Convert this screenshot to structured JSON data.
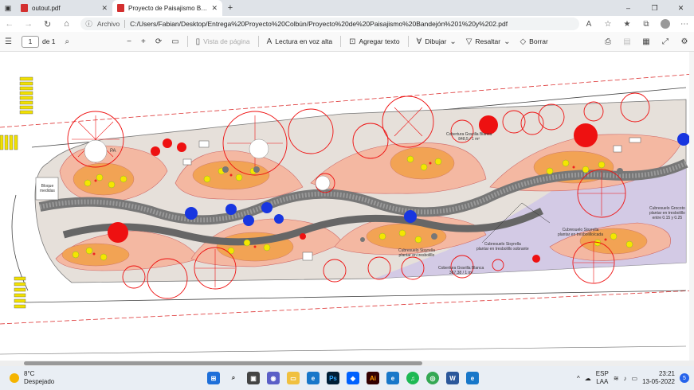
{
  "tabs": [
    {
      "title": "outout.pdf",
      "close": "✕"
    },
    {
      "title": "Proyecto de Paisajismo Bandejó",
      "close": "✕"
    }
  ],
  "window_controls": [
    "–",
    "❐",
    "✕"
  ],
  "address": {
    "scheme": "Archivo",
    "url": "C:/Users/Fabian/Desktop/Entrega%20Proyecto%20Colbún/Proyecto%20de%20Paisajismo%20Bandejón%201%20y%202.pdf"
  },
  "pdf_toolbar": {
    "page_current": "1",
    "page_total": "de 1",
    "view_page": "Vista de página",
    "read_aloud": "Lectura en voz alta",
    "add_text": "Agregar texto",
    "draw": "Dibujar",
    "highlight": "Resaltar",
    "erase": "Borrar"
  },
  "plan_labels": {
    "cobertura_top": "Cobertura Gravilla Blanca\n848,5 / 1 m²",
    "cubresuelo_right": "Cubresuelo Grocoto\nplantar en tresbolillo\nentre 0.15 y 0.25",
    "cubresuelo_mid": "Cubresuelo Sisyrella\nplantar en tresbolillo/cada",
    "cubresuelo_left": "Cubresuelo Sisyrella\nplantar en tresbolillo sobrante",
    "cobertura_bottom": "Cobertura Gravilla Blanca\n387,38 / 1 m²",
    "cubresuelo_low": "Cubresuelo Sisyrella\nplantar en tresbolillo",
    "pa_mark": "PA",
    "bloque": "Bloque\nmedidas"
  },
  "taskbar": {
    "weather_temp": "8°C",
    "weather_desc": "Despejado",
    "lang_top": "ESP",
    "lang_bottom": "LAA",
    "time": "23:21",
    "date": "13-05-2022",
    "notifications": "5"
  }
}
